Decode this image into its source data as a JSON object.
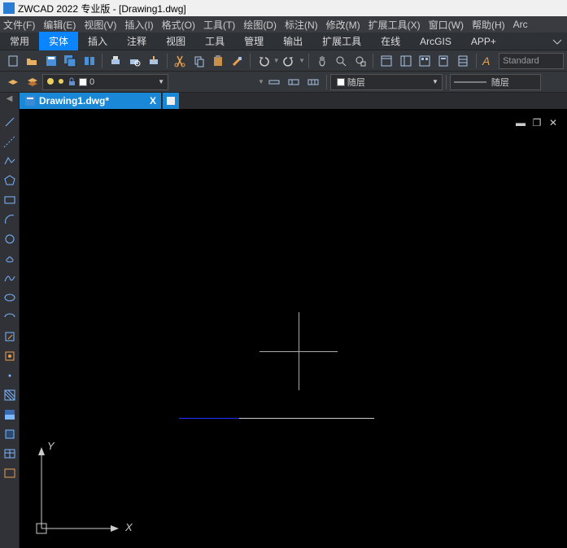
{
  "title": "ZWCAD 2022 专业版 - [Drawing1.dwg]",
  "menus": [
    "文件(F)",
    "编辑(E)",
    "视图(V)",
    "插入(I)",
    "格式(O)",
    "工具(T)",
    "绘图(D)",
    "标注(N)",
    "修改(M)",
    "扩展工具(X)",
    "窗口(W)",
    "帮助(H)",
    "Arc"
  ],
  "ribbon_tabs": [
    "常用",
    "实体",
    "插入",
    "注释",
    "视图",
    "工具",
    "管理",
    "输出",
    "扩展工具",
    "在线",
    "ArcGIS",
    "APP+"
  ],
  "active_ribbon": 1,
  "layers_row": {
    "layer_input": "0",
    "layer_combo": "随层",
    "line_combo": "随层"
  },
  "doc_tab": {
    "name": "Drawing1.dwg*",
    "close": "X"
  },
  "ucs": {
    "x": "X",
    "y": "Y"
  },
  "style_text": "Standard"
}
